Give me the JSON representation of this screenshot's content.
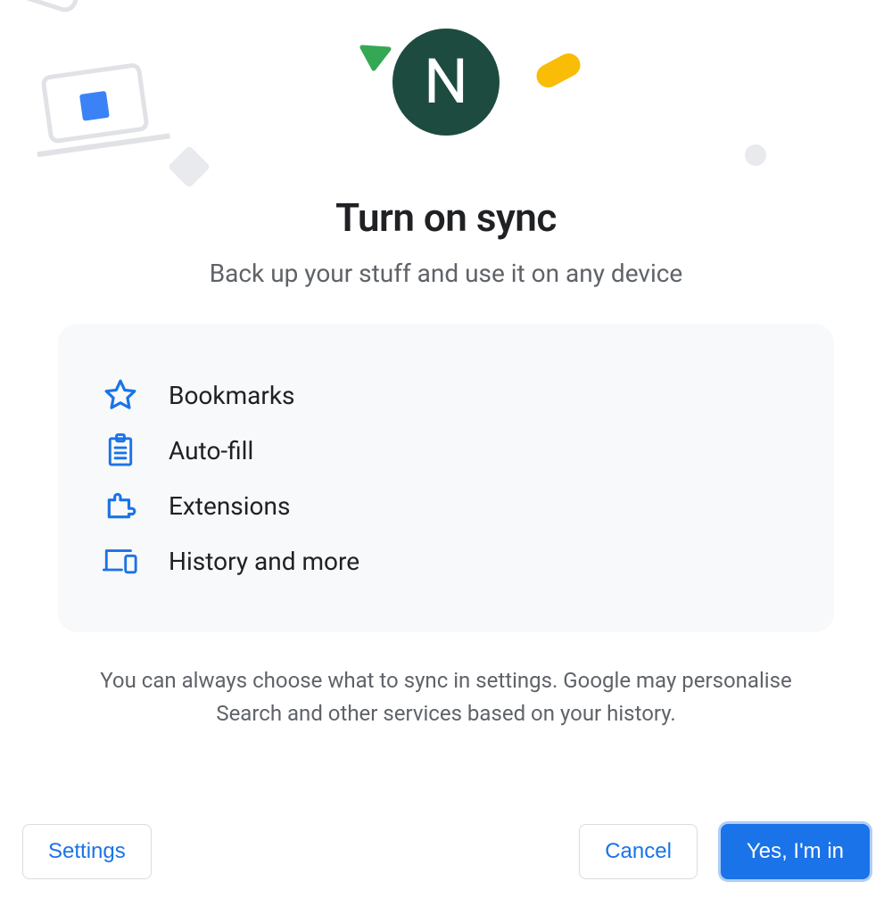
{
  "avatar": {
    "initial": "N",
    "bg": "#1e4b40"
  },
  "heading": {
    "title": "Turn on sync",
    "subtitle": "Back up your stuff and use it on any device"
  },
  "items": [
    {
      "label": "Bookmarks",
      "icon": "star-icon"
    },
    {
      "label": "Auto-fill",
      "icon": "clipboard-icon"
    },
    {
      "label": "Extensions",
      "icon": "extension-icon"
    },
    {
      "label": "History and more",
      "icon": "devices-icon"
    }
  ],
  "note": "You can always choose what to sync in settings. Google may personalise Search and other services based on your history.",
  "buttons": {
    "settings": "Settings",
    "cancel": "Cancel",
    "confirm": "Yes, I'm in"
  },
  "colors": {
    "accent": "#1a73e8"
  }
}
